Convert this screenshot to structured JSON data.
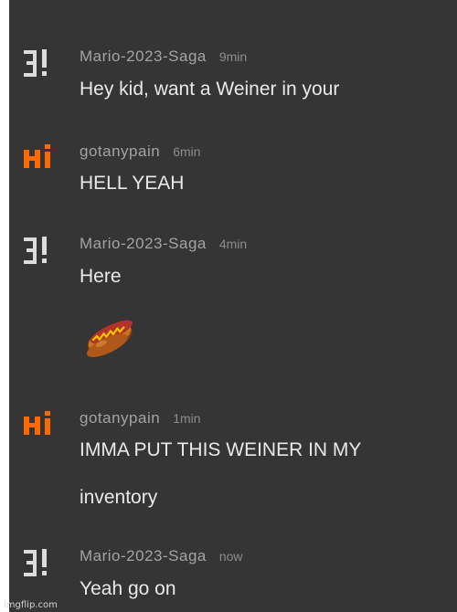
{
  "messages": [
    {
      "user": "Mario-2023-Saga",
      "time": "9min",
      "avatar": "3!-logo-icon",
      "lines": [
        "Hey kid, want a Weiner in your"
      ]
    },
    {
      "user": "gotanypain",
      "time": "6min",
      "avatar": "hi-logo-icon",
      "lines": [
        "HELL YEAH"
      ]
    },
    {
      "user": "Mario-2023-Saga",
      "time": "4min",
      "avatar": "3!-logo-icon",
      "lines": [
        "Here"
      ],
      "attachment": "hotdog-emoji"
    },
    {
      "user": "gotanypain",
      "time": "1min",
      "avatar": "hi-logo-icon",
      "lines": [
        "IMMA PUT THIS WEINER IN MY",
        "inventory"
      ]
    },
    {
      "user": "Mario-2023-Saga",
      "time": "now",
      "avatar": "3!-logo-icon",
      "lines": [
        "Yeah go on"
      ]
    }
  ],
  "watermark": "imgflip.com",
  "colors": {
    "background": "#353535",
    "username": "#a3a3a3",
    "timestamp": "#8c8c8c",
    "message": "#e9e9e9",
    "hi_logo": "#ff6a00",
    "three_logo": "#dcdcdc"
  }
}
